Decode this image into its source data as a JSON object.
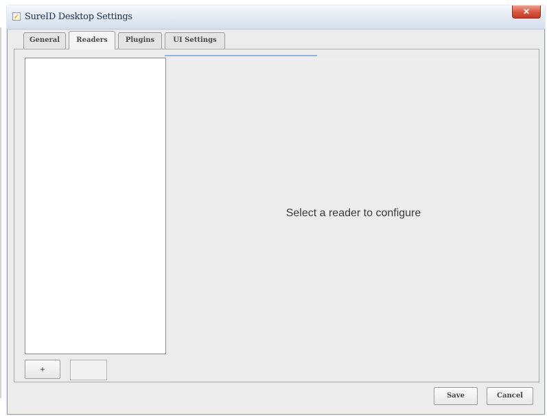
{
  "window": {
    "title": "SureID Desktop Settings",
    "close_symbol": "✕"
  },
  "tabs": [
    {
      "label": "General",
      "active": false
    },
    {
      "label": "Readers",
      "active": true
    },
    {
      "label": "Plugins",
      "active": false
    },
    {
      "label": "UI Settings",
      "active": false
    }
  ],
  "detail": {
    "message": "Select a reader to configure"
  },
  "list_actions": {
    "add_label": "+"
  },
  "footer": {
    "save_label": "Save",
    "cancel_label": "Cancel"
  },
  "icons": {
    "app": "app-icon",
    "close": "close-icon"
  },
  "colors": {
    "accent": "#8fb3d9",
    "close_button": "#d8553d"
  }
}
